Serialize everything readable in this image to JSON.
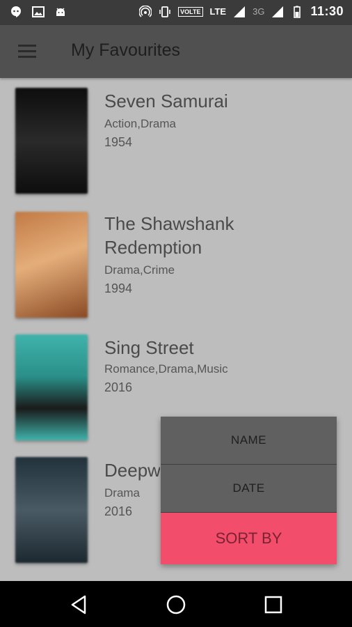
{
  "status_bar": {
    "time": "11:30",
    "lte": "LTE",
    "volte": "VOLTE",
    "network_3g": "3G",
    "icons": [
      "hangouts-icon",
      "image-icon",
      "android-icon",
      "hotspot-icon",
      "vibrate-icon",
      "volte-icon",
      "lte-icon",
      "signal-icon",
      "signal-3g-icon",
      "battery-icon"
    ]
  },
  "app_bar": {
    "title": "My Favourites",
    "menu_icon": "hamburger-menu-icon"
  },
  "movies": [
    {
      "title": "Seven Samurai",
      "genres": "Action,Drama",
      "year": "1954",
      "poster_colors": [
        "#111111",
        "#2a2a2a"
      ]
    },
    {
      "title": "The Shawshank Redemption",
      "genres": "Drama,Crime",
      "year": "1994",
      "poster_colors": [
        "#b86a3a",
        "#e0a070"
      ]
    },
    {
      "title": "Sing Street",
      "genres": "Romance,Drama,Music",
      "year": "2016",
      "poster_colors": [
        "#3aa7a0",
        "#222222"
      ]
    },
    {
      "title": "Deepwater Horizon",
      "genres": "Drama",
      "year": "2016",
      "poster_colors": [
        "#2a3b46",
        "#8a8f92"
      ]
    }
  ],
  "sort_menu": {
    "options": [
      "NAME",
      "DATE"
    ],
    "button_label": "SORT BY",
    "accent_color": "#f24d6a"
  },
  "nav_bar": {
    "icons": [
      "back-triangle-icon",
      "home-circle-icon",
      "recents-square-icon"
    ]
  }
}
